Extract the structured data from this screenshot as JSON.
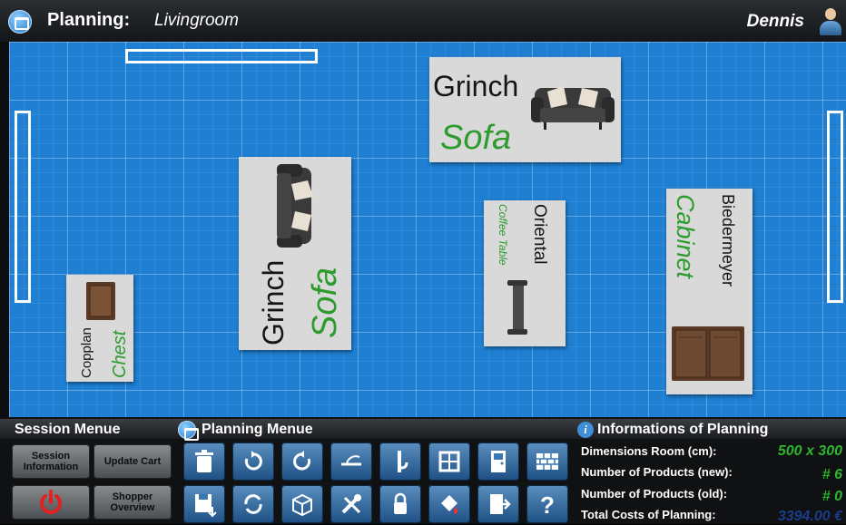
{
  "header": {
    "title": "Planning:",
    "room": "Livingroom",
    "user": "Dennis"
  },
  "canvas": {
    "items": [
      {
        "brand": "Grinch",
        "type": "Sofa"
      },
      {
        "brand": "Grinch",
        "type": "Sofa"
      },
      {
        "brand": "Oriental",
        "type": "Coffee Table"
      },
      {
        "brand": "Biedermeyer",
        "type": "Cabinet"
      },
      {
        "brand": "Copplan",
        "type": "Chest"
      }
    ]
  },
  "session_menu": {
    "title": "Session Menue",
    "buttons": {
      "session_info": "Session Information",
      "update_cart": "Update Cart",
      "shopper_overview": "Shopper Overview"
    }
  },
  "planning_menu": {
    "title": "Planning Menue",
    "icons": [
      "trash-icon",
      "rotate-left-icon",
      "rotate-right-icon",
      "door-swing-icon",
      "pipe-icon",
      "window-icon",
      "door-icon",
      "brick-wall-icon",
      "save-icon",
      "refresh-icon",
      "box-add-icon",
      "tools-icon",
      "lock-icon",
      "paint-bucket-icon",
      "exit-icon",
      "help-icon"
    ]
  },
  "info": {
    "title": "Informations of Planning",
    "dimensions_label": "Dimensions Room (cm):",
    "dimensions_value": "500 x 300",
    "new_label": "Number of Products (new):",
    "new_value": "# 6",
    "old_label": "Number of Products (old):",
    "old_value": "# 0",
    "total_label": "Total Costs of Planning:",
    "total_value": "3394.00 €"
  },
  "colors": {
    "grid": "#1e7fd3",
    "accent_green": "#2d9b2d",
    "total_value": "#1a3d8a"
  }
}
